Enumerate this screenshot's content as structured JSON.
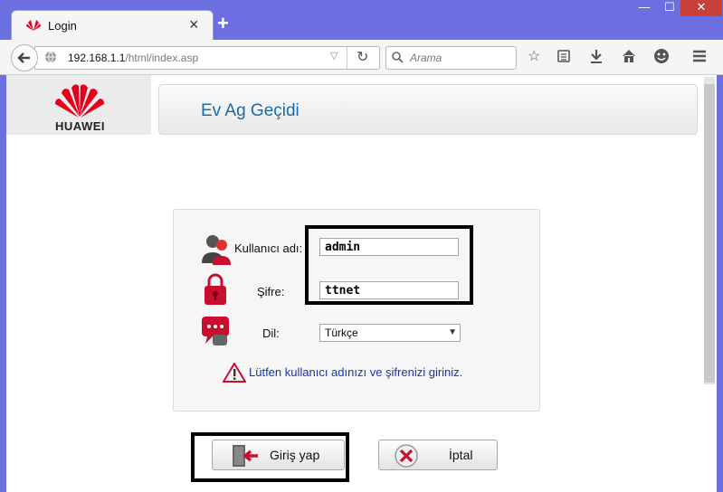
{
  "browser": {
    "tab_title": "Login",
    "tab_close": "×",
    "new_tab": "+",
    "window_controls": {
      "minimize": "—",
      "maximize": "☐",
      "close": "✕"
    },
    "url_host": "192.168.1.1",
    "url_path": "/html/index.asp",
    "search_placeholder": "Arama"
  },
  "header": {
    "brand": "HUAWEI",
    "title": "Ev Ag Geçidi"
  },
  "login": {
    "username_label": "Kullanıcı adı:",
    "username_value": "admin",
    "password_label": "Şifre:",
    "password_value": "ttnet",
    "language_label": "Dil:",
    "language_value": "Türkçe",
    "hint": "Lütfen kullanıcı adınızı ve şifrenizi giriniz.",
    "login_button": "Giriş yap",
    "cancel_button": "İptal"
  },
  "colors": {
    "accent_title": "#1a6aa8",
    "hint": "#1a35a8",
    "brand_red": "#e3001b",
    "icon_red": "#c8102e"
  }
}
